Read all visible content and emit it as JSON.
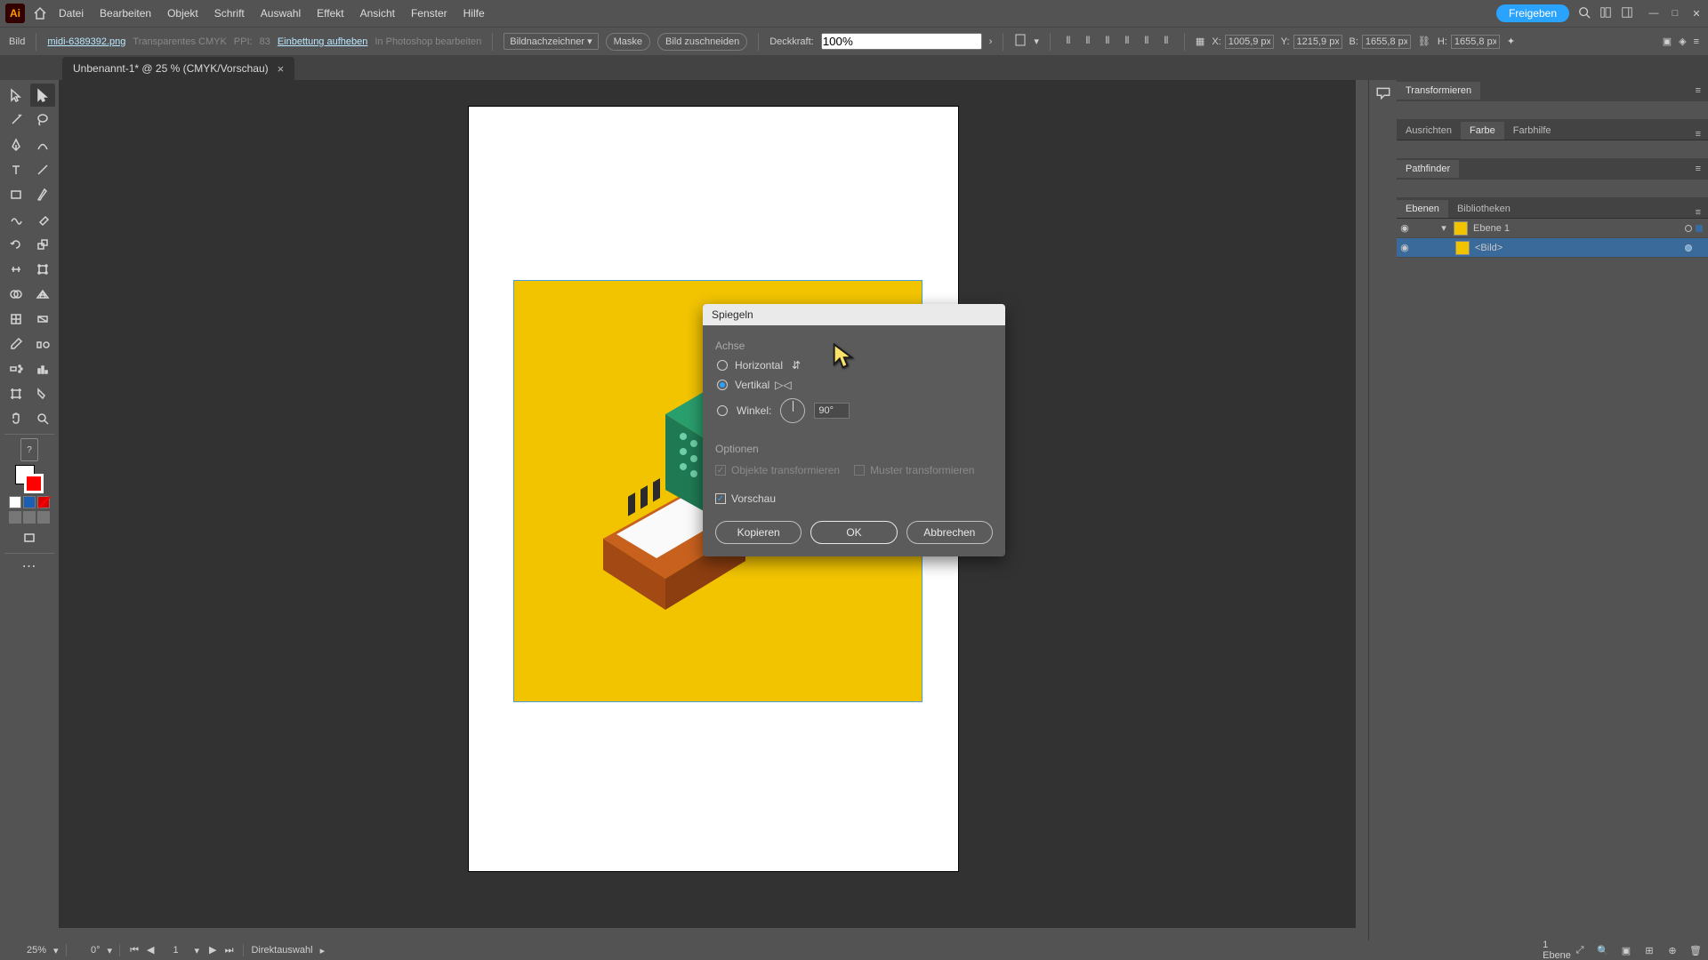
{
  "menu": {
    "items": [
      "Datei",
      "Bearbeiten",
      "Objekt",
      "Schrift",
      "Auswahl",
      "Effekt",
      "Ansicht",
      "Fenster",
      "Hilfe"
    ],
    "share": "Freigeben"
  },
  "controlbar": {
    "objLabel": "Bild",
    "filename": "midi-6389392.png",
    "colormode": "Transparentes CMYK",
    "ppiLabel": "PPI:",
    "ppi": "83",
    "unembed": "Einbettung aufheben",
    "editPs": "In Photoshop bearbeiten",
    "imageTrace": "Bildnachzeichner",
    "mask": "Maske",
    "crop": "Bild zuschneiden",
    "opacityLabel": "Deckkraft:",
    "opacity": "100%",
    "x": "1005,9 px",
    "y": "1215,9 px",
    "w": "1655,8 px",
    "h": "1655,8 px"
  },
  "tab": {
    "title": "Unbenannt-1* @ 25 % (CMYK/Vorschau)"
  },
  "dialog": {
    "title": "Spiegeln",
    "axisGroup": "Achse",
    "horizontal": "Horizontal",
    "vertical": "Vertikal",
    "angleLabel": "Winkel:",
    "angleValue": "90°",
    "optionsGroup": "Optionen",
    "transformObjects": "Objekte transformieren",
    "transformPatterns": "Muster transformieren",
    "preview": "Vorschau",
    "copy": "Kopieren",
    "ok": "OK",
    "cancel": "Abbrechen"
  },
  "panels": {
    "transform": "Transformieren",
    "align": "Ausrichten",
    "color": "Farbe",
    "colorGuide": "Farbhilfe",
    "pathfinder": "Pathfinder",
    "layersTab": "Ebenen",
    "librariesTab": "Bibliotheken",
    "layer1": "Ebene 1",
    "imageItem": "<Bild>"
  },
  "status": {
    "zoom": "25%",
    "rotate": "0°",
    "page": "1",
    "toolname": "Direktauswahl",
    "layerCount": "1 Ebene"
  }
}
